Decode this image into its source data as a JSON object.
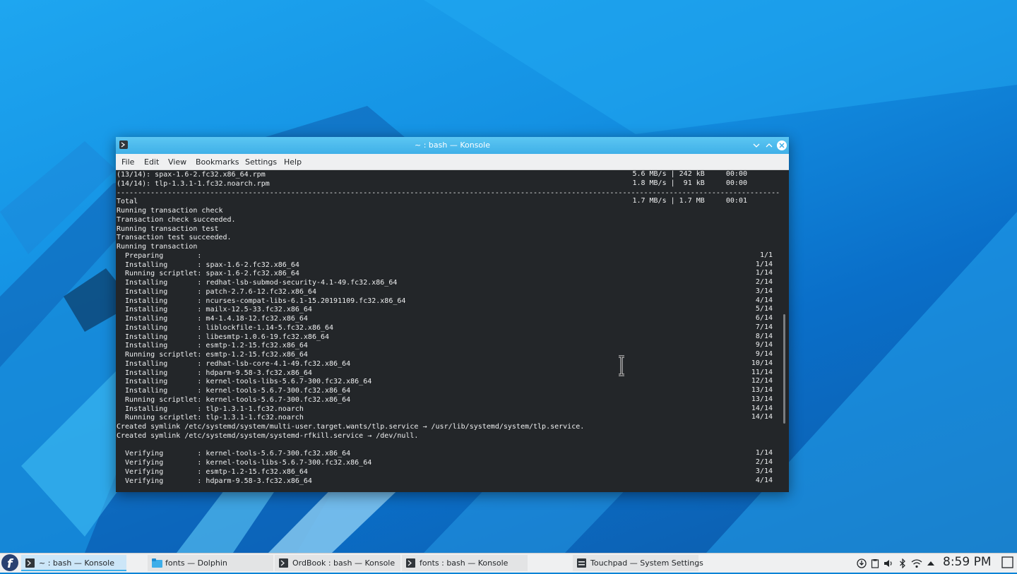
{
  "window": {
    "title": "~ : bash — Konsole",
    "menu": [
      "File",
      "Edit",
      "View",
      "Bookmarks",
      "Settings",
      "Help"
    ]
  },
  "terminal": {
    "lines": [
      {
        "left": "(13/14): spax-1.6-2.fc32.x86_64.rpm",
        "right": "5.6 MB/s | 242 kB     00:00"
      },
      {
        "left": "(14/14): tlp-1.3.1-1.fc32.noarch.rpm",
        "right": "1.8 MB/s |  91 kB     00:00"
      },
      {
        "left": "--------------------------------------------------------------------------------------------------------------------------------------------------------------------",
        "right": ""
      },
      {
        "left": "Total",
        "right": "1.7 MB/s | 1.7 MB     00:01"
      },
      {
        "left": "Running transaction check",
        "right": ""
      },
      {
        "left": "Transaction check succeeded.",
        "right": ""
      },
      {
        "left": "Running transaction test",
        "right": ""
      },
      {
        "left": "Transaction test succeeded.",
        "right": ""
      },
      {
        "left": "Running transaction",
        "right": ""
      },
      {
        "left": "  Preparing        :",
        "right": "1/1"
      },
      {
        "left": "  Installing       : spax-1.6-2.fc32.x86_64",
        "right": "1/14"
      },
      {
        "left": "  Running scriptlet: spax-1.6-2.fc32.x86_64",
        "right": "1/14"
      },
      {
        "left": "  Installing       : redhat-lsb-submod-security-4.1-49.fc32.x86_64",
        "right": "2/14"
      },
      {
        "left": "  Installing       : patch-2.7.6-12.fc32.x86_64",
        "right": "3/14"
      },
      {
        "left": "  Installing       : ncurses-compat-libs-6.1-15.20191109.fc32.x86_64",
        "right": "4/14"
      },
      {
        "left": "  Installing       : mailx-12.5-33.fc32.x86_64",
        "right": "5/14"
      },
      {
        "left": "  Installing       : m4-1.4.18-12.fc32.x86_64",
        "right": "6/14"
      },
      {
        "left": "  Installing       : liblockfile-1.14-5.fc32.x86_64",
        "right": "7/14"
      },
      {
        "left": "  Installing       : libesmtp-1.0.6-19.fc32.x86_64",
        "right": "8/14"
      },
      {
        "left": "  Installing       : esmtp-1.2-15.fc32.x86_64",
        "right": "9/14"
      },
      {
        "left": "  Running scriptlet: esmtp-1.2-15.fc32.x86_64",
        "right": "9/14"
      },
      {
        "left": "  Installing       : redhat-lsb-core-4.1-49.fc32.x86_64",
        "right": "10/14"
      },
      {
        "left": "  Installing       : hdparm-9.58-3.fc32.x86_64",
        "right": "11/14"
      },
      {
        "left": "  Installing       : kernel-tools-libs-5.6.7-300.fc32.x86_64",
        "right": "12/14"
      },
      {
        "left": "  Installing       : kernel-tools-5.6.7-300.fc32.x86_64",
        "right": "13/14"
      },
      {
        "left": "  Running scriptlet: kernel-tools-5.6.7-300.fc32.x86_64",
        "right": "13/14"
      },
      {
        "left": "  Installing       : tlp-1.3.1-1.fc32.noarch",
        "right": "14/14"
      },
      {
        "left": "  Running scriptlet: tlp-1.3.1-1.fc32.noarch",
        "right": "14/14"
      },
      {
        "left": "Created symlink /etc/systemd/system/multi-user.target.wants/tlp.service → /usr/lib/systemd/system/tlp.service.",
        "right": ""
      },
      {
        "left": "Created symlink /etc/systemd/system/systemd-rfkill.service → /dev/null.",
        "right": ""
      },
      {
        "left": "",
        "right": ""
      },
      {
        "left": "  Verifying        : kernel-tools-5.6.7-300.fc32.x86_64",
        "right": "1/14"
      },
      {
        "left": "  Verifying        : kernel-tools-libs-5.6.7-300.fc32.x86_64",
        "right": "2/14"
      },
      {
        "left": "  Verifying        : esmtp-1.2-15.fc32.x86_64",
        "right": "3/14"
      },
      {
        "left": "  Verifying        : hdparm-9.58-3.fc32.x86_64",
        "right": "4/14"
      }
    ]
  },
  "taskbar": {
    "tasks": [
      {
        "label": "~ : bash — Konsole",
        "icon": "konsole-icon",
        "active": true
      },
      {
        "label": "fonts — Dolphin",
        "icon": "dolphin-icon",
        "active": false
      },
      {
        "label": "OrdBook : bash — Konsole",
        "icon": "konsole-icon",
        "active": false
      },
      {
        "label": "fonts : bash — Konsole",
        "icon": "konsole-icon",
        "active": false
      },
      {
        "label": "Touchpad  — System Settings",
        "icon": "system-settings-icon",
        "active": false
      }
    ],
    "tray_icons": [
      "updates-icon",
      "clipboard-icon",
      "volume-icon",
      "bluetooth-icon",
      "wifi-icon",
      "tray-expand-icon"
    ],
    "clock": "8:59 PM"
  },
  "colors": {
    "accent": "#3daee9",
    "terminal_bg": "#232629",
    "terminal_fg": "#eff0f1",
    "titlebar": "#4fbcee",
    "desktop": "#1491e3"
  }
}
